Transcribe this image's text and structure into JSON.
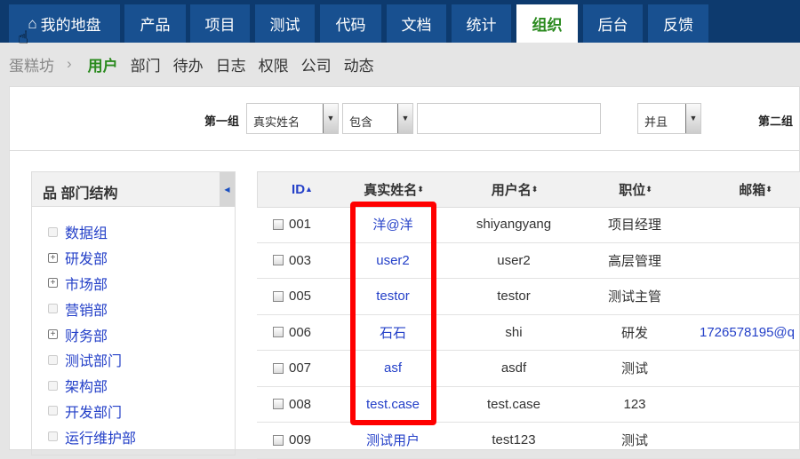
{
  "nav": {
    "tabs": [
      "我的地盘",
      "产品",
      "项目",
      "测试",
      "代码",
      "文档",
      "统计",
      "组织",
      "后台",
      "反馈"
    ],
    "active": "组织"
  },
  "subnav": {
    "root": "蛋糕坊",
    "sep": "›",
    "items": [
      "用户",
      "部门",
      "待办",
      "日志",
      "权限",
      "公司",
      "动态"
    ],
    "active": "用户"
  },
  "filter": {
    "group1_label": "第一组",
    "field": "真实姓名",
    "operator": "包含",
    "value": "",
    "logic": "并且",
    "group2_label": "第二组"
  },
  "tree": {
    "title": "部门结构",
    "items": [
      {
        "label": "数据组",
        "expandable": false
      },
      {
        "label": "研发部",
        "expandable": true
      },
      {
        "label": "市场部",
        "expandable": true
      },
      {
        "label": "营销部",
        "expandable": false
      },
      {
        "label": "财务部",
        "expandable": true
      },
      {
        "label": "测试部门",
        "expandable": false
      },
      {
        "label": "架构部",
        "expandable": false
      },
      {
        "label": "开发部门",
        "expandable": false
      },
      {
        "label": "运行维护部",
        "expandable": false
      }
    ]
  },
  "table": {
    "headers": [
      "ID",
      "真实姓名",
      "用户名",
      "职位",
      "邮箱"
    ],
    "rows": [
      {
        "id": "001",
        "realname": "洋@洋",
        "account": "shiyangyang",
        "role": "项目经理",
        "email": ""
      },
      {
        "id": "003",
        "realname": "user2",
        "account": "user2",
        "role": "高层管理",
        "email": ""
      },
      {
        "id": "005",
        "realname": "testor",
        "account": "testor",
        "role": "测试主管",
        "email": ""
      },
      {
        "id": "006",
        "realname": "石石",
        "account": "shi",
        "role": "研发",
        "email": "1726578195@q"
      },
      {
        "id": "007",
        "realname": "asf",
        "account": "asdf",
        "role": "测试",
        "email": ""
      },
      {
        "id": "008",
        "realname": "test.case",
        "account": "test.case",
        "role": "123",
        "email": ""
      },
      {
        "id": "009",
        "realname": "测试用户",
        "account": "test123",
        "role": "测试",
        "email": ""
      }
    ]
  }
}
